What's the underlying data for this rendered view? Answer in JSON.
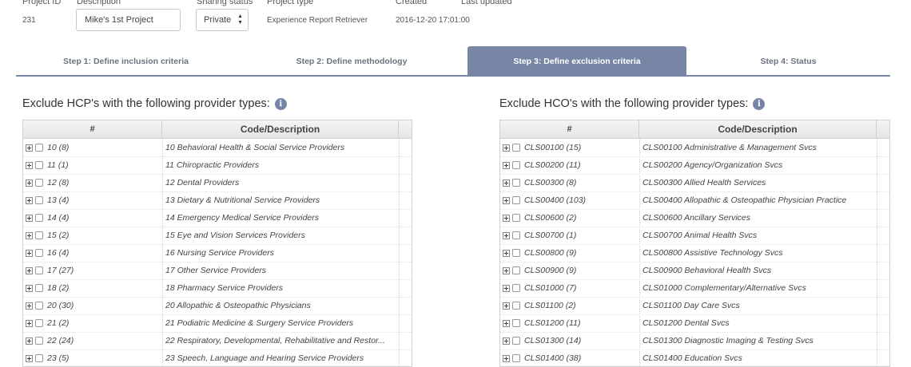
{
  "project": {
    "headers": {
      "id": "Project ID",
      "description": "Description",
      "sharing": "Sharing status",
      "type": "Project type",
      "created": "Created",
      "updated": "Last updated"
    },
    "id": "231",
    "description": "Mike's 1st Project",
    "sharing": "Private",
    "type": "Experience Report Retriever",
    "created": "2016-12-20 17:01:00",
    "updated": ""
  },
  "steps": [
    {
      "label": "Step 1: Define inclusion criteria",
      "active": false
    },
    {
      "label": "Step 2: Define methodology",
      "active": false
    },
    {
      "label": "Step 3: Define exclusion criteria",
      "active": true
    },
    {
      "label": "Step 4: Status",
      "active": false
    }
  ],
  "hcp": {
    "title": "Exclude HCP's with the following provider types:",
    "col_code": "#",
    "col_desc": "Code/Description",
    "rows": [
      {
        "code": "10 (8)",
        "desc": "10 Behavioral Health & Social Service Providers"
      },
      {
        "code": "11 (1)",
        "desc": "11 Chiropractic Providers"
      },
      {
        "code": "12 (8)",
        "desc": "12 Dental Providers"
      },
      {
        "code": "13 (4)",
        "desc": "13 Dietary & Nutritional Service Providers"
      },
      {
        "code": "14 (4)",
        "desc": "14 Emergency Medical Service Providers"
      },
      {
        "code": "15 (2)",
        "desc": "15 Eye and Vision Services Providers"
      },
      {
        "code": "16 (4)",
        "desc": "16 Nursing Service Providers"
      },
      {
        "code": "17 (27)",
        "desc": "17 Other Service Providers"
      },
      {
        "code": "18 (2)",
        "desc": "18 Pharmacy Service Providers"
      },
      {
        "code": "20 (30)",
        "desc": "20 Allopathic & Osteopathic Physicians"
      },
      {
        "code": "21 (2)",
        "desc": "21 Podiatric Medicine & Surgery Service Providers"
      },
      {
        "code": "22 (24)",
        "desc": "22 Respiratory, Developmental, Rehabilitative and Restor..."
      },
      {
        "code": "23 (5)",
        "desc": "23 Speech, Language and Hearing Service Providers"
      }
    ]
  },
  "hco": {
    "title": "Exclude HCO's with the following provider types:",
    "col_code": "#",
    "col_desc": "Code/Description",
    "rows": [
      {
        "code": "CLS00100 (15)",
        "desc": "CLS00100 Administrative & Management Svcs"
      },
      {
        "code": "CLS00200 (11)",
        "desc": "CLS00200 Agency/Organization Svcs"
      },
      {
        "code": "CLS00300 (8)",
        "desc": "CLS00300 Allied Health Services"
      },
      {
        "code": "CLS00400 (103)",
        "desc": "CLS00400 Allopathic & Osteopathic Physician Practice"
      },
      {
        "code": "CLS00600 (2)",
        "desc": "CLS00600 Ancillary Services"
      },
      {
        "code": "CLS00700 (1)",
        "desc": "CLS00700 Animal Health Svcs"
      },
      {
        "code": "CLS00800 (9)",
        "desc": "CLS00800 Assistive Technology Svcs"
      },
      {
        "code": "CLS00900 (9)",
        "desc": "CLS00900 Behavioral Health Svcs"
      },
      {
        "code": "CLS01000 (7)",
        "desc": "CLS01000 Complementary/Alternative Svcs"
      },
      {
        "code": "CLS01100 (2)",
        "desc": "CLS01100 Day Care Svcs"
      },
      {
        "code": "CLS01200 (11)",
        "desc": "CLS01200 Dental Svcs"
      },
      {
        "code": "CLS01300 (14)",
        "desc": "CLS01300 Diagnostic Imaging & Testing Svcs"
      },
      {
        "code": "CLS01400 (38)",
        "desc": "CLS01400 Education Svcs"
      }
    ]
  },
  "icons": {
    "info": "info-icon",
    "expander": "plus-box-icon",
    "sort": "updown-arrows-icon"
  },
  "colors": {
    "accent": "#7886a6",
    "step_line": "#7a88a8"
  }
}
